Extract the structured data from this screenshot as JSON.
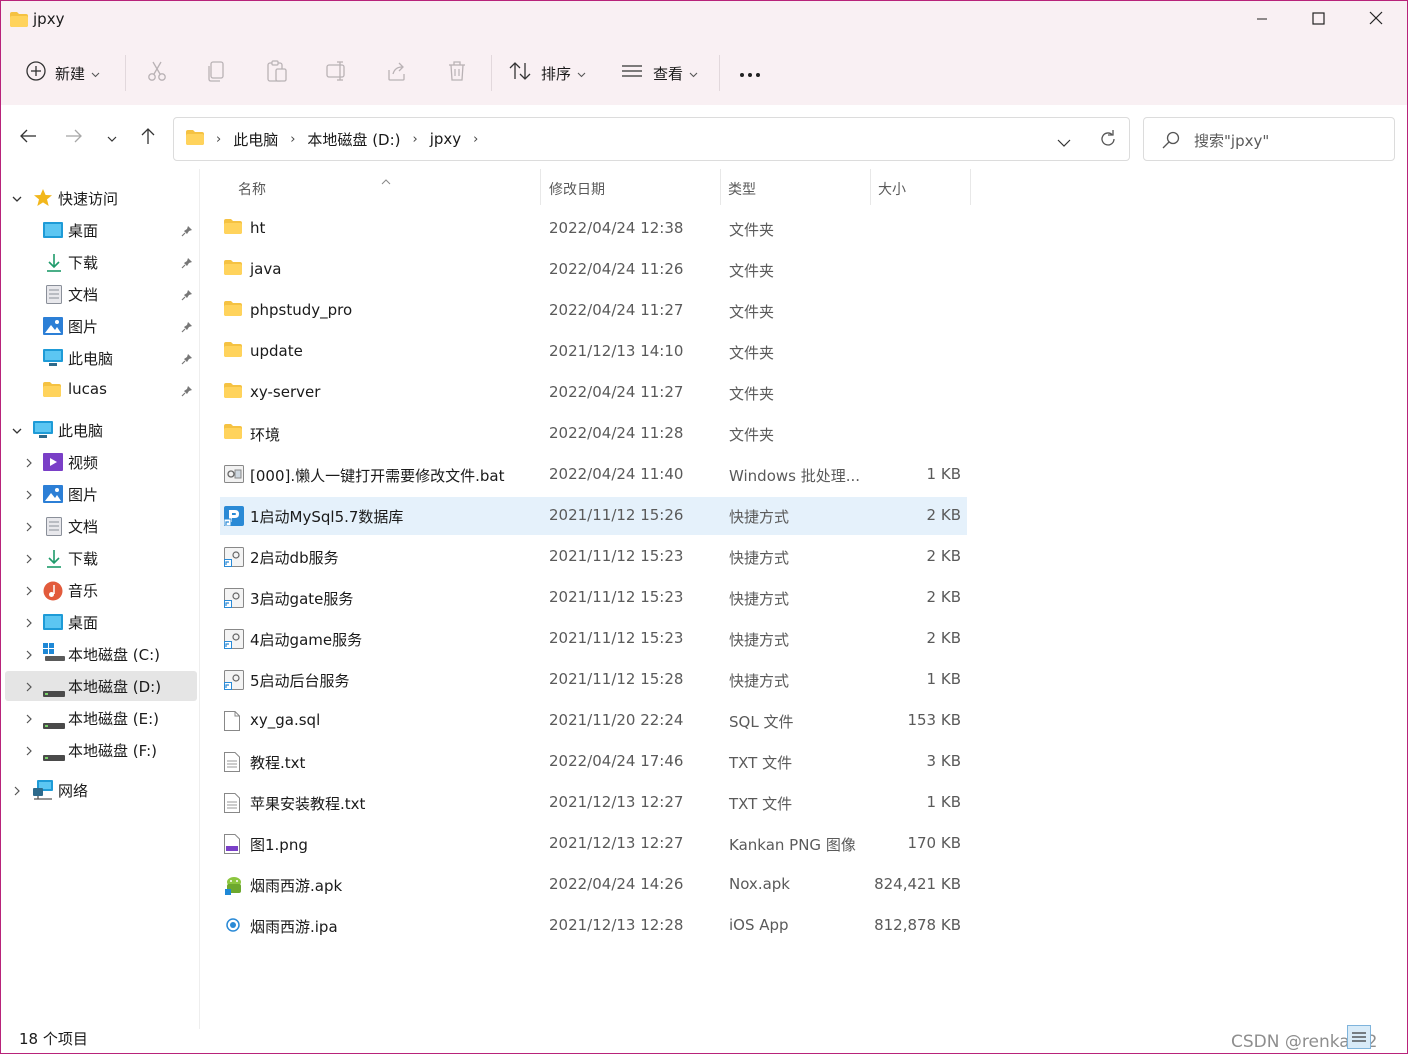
{
  "window": {
    "title": "jpxy"
  },
  "commands": {
    "new_label": "新建",
    "sort_label": "排序",
    "view_label": "查看"
  },
  "address": {
    "crumbs": [
      "此电脑",
      "本地磁盘 (D:)",
      "jpxy"
    ],
    "search_placeholder": "搜索\"jpxy\""
  },
  "sidebar": {
    "quick_access": "快速访问",
    "quick_items": [
      "桌面",
      "下载",
      "文档",
      "图片",
      "此电脑",
      "lucas"
    ],
    "this_pc": "此电脑",
    "pc_items": [
      "视频",
      "图片",
      "文档",
      "下载",
      "音乐",
      "桌面",
      "本地磁盘 (C:)",
      "本地磁盘 (D:)",
      "本地磁盘 (E:)",
      "本地磁盘 (F:)"
    ],
    "network": "网络"
  },
  "columns": {
    "name": "名称",
    "date": "修改日期",
    "type": "类型",
    "size": "大小"
  },
  "files": [
    {
      "name": "ht",
      "date": "2022/04/24 12:38",
      "type": "文件夹",
      "size": "",
      "icon": "folder"
    },
    {
      "name": "java",
      "date": "2022/04/24 11:26",
      "type": "文件夹",
      "size": "",
      "icon": "folder"
    },
    {
      "name": "phpstudy_pro",
      "date": "2022/04/24 11:27",
      "type": "文件夹",
      "size": "",
      "icon": "folder"
    },
    {
      "name": "update",
      "date": "2021/12/13 14:10",
      "type": "文件夹",
      "size": "",
      "icon": "folder"
    },
    {
      "name": "xy-server",
      "date": "2022/04/24 11:27",
      "type": "文件夹",
      "size": "",
      "icon": "folder"
    },
    {
      "name": "环境",
      "date": "2022/04/24 11:28",
      "type": "文件夹",
      "size": "",
      "icon": "folder"
    },
    {
      "name": "[000].懒人一键打开需要修改文件.bat",
      "date": "2022/04/24 11:40",
      "type": "Windows 批处理...",
      "size": "1 KB",
      "icon": "bat"
    },
    {
      "name": "1启动MySql5.7数据库",
      "date": "2021/11/12 15:26",
      "type": "快捷方式",
      "size": "2 KB",
      "icon": "shortcut-blue"
    },
    {
      "name": "2启动db服务",
      "date": "2021/11/12 15:23",
      "type": "快捷方式",
      "size": "2 KB",
      "icon": "shortcut"
    },
    {
      "name": "3启动gate服务",
      "date": "2021/11/12 15:23",
      "type": "快捷方式",
      "size": "2 KB",
      "icon": "shortcut"
    },
    {
      "name": "4启动game服务",
      "date": "2021/11/12 15:23",
      "type": "快捷方式",
      "size": "2 KB",
      "icon": "shortcut"
    },
    {
      "name": "5启动后台服务",
      "date": "2021/11/12 15:28",
      "type": "快捷方式",
      "size": "1 KB",
      "icon": "shortcut"
    },
    {
      "name": "xy_ga.sql",
      "date": "2021/11/20 22:24",
      "type": "SQL 文件",
      "size": "153 KB",
      "icon": "file"
    },
    {
      "name": "教程.txt",
      "date": "2022/04/24 17:46",
      "type": "TXT 文件",
      "size": "3 KB",
      "icon": "txt"
    },
    {
      "name": "苹果安装教程.txt",
      "date": "2021/12/13 12:27",
      "type": "TXT 文件",
      "size": "1 KB",
      "icon": "txt"
    },
    {
      "name": "图1.png",
      "date": "2021/12/13 12:27",
      "type": "Kankan PNG 图像",
      "size": "170 KB",
      "icon": "png"
    },
    {
      "name": "烟雨西游.apk",
      "date": "2022/04/24 14:26",
      "type": "Nox.apk",
      "size": "824,421 KB",
      "icon": "apk"
    },
    {
      "name": "烟雨西游.ipa",
      "date": "2021/12/13 12:28",
      "type": "iOS App",
      "size": "812,878 KB",
      "icon": "ipa"
    }
  ],
  "selected_file_index": 7,
  "status": {
    "item_count": "18 个项目"
  },
  "watermark": "CSDN @renka记2"
}
